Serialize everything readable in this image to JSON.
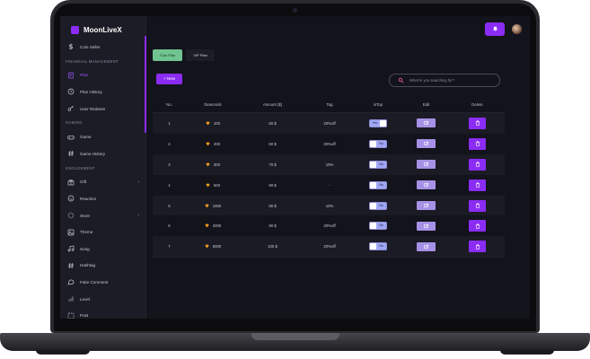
{
  "app": {
    "brand": "MoonLiveX"
  },
  "sidebar": {
    "items": [
      {
        "type": "item",
        "label": "Coin Seller",
        "icon": "dollar-icon"
      },
      {
        "type": "section",
        "label": "FINANCIAL MANAGEMENT"
      },
      {
        "type": "item",
        "label": "Plan",
        "icon": "plan-icon",
        "active": true
      },
      {
        "type": "item",
        "label": "Plan History",
        "icon": "clock-icon"
      },
      {
        "type": "item",
        "label": "User Redeem",
        "icon": "key-icon"
      },
      {
        "type": "section",
        "label": "GAMING"
      },
      {
        "type": "item",
        "label": "Game",
        "icon": "gamepad-icon"
      },
      {
        "type": "item",
        "label": "Game History",
        "icon": "hash-icon"
      },
      {
        "type": "section",
        "label": "ENGAGEMENT"
      },
      {
        "type": "item",
        "label": "Gift",
        "icon": "gift-icon",
        "chevron": "›"
      },
      {
        "type": "item",
        "label": "Reaction",
        "icon": "smile-icon"
      },
      {
        "type": "item",
        "label": "Store",
        "icon": "loader-icon",
        "chevron": "›"
      },
      {
        "type": "item",
        "label": "Theme",
        "icon": "image-icon"
      },
      {
        "type": "item",
        "label": "Song",
        "icon": "music-icon"
      },
      {
        "type": "item",
        "label": "Hashtag",
        "icon": "hash-icon"
      },
      {
        "type": "item",
        "label": "Fake Comment",
        "icon": "comment-icon"
      },
      {
        "type": "item",
        "label": "Level",
        "icon": "bar-chart-icon"
      },
      {
        "type": "item",
        "label": "Post",
        "icon": "post-icon"
      }
    ]
  },
  "tabs": [
    {
      "label": "Coin Plan",
      "active": true
    },
    {
      "label": "VIP Plan",
      "active": false
    }
  ],
  "toolbar": {
    "new_label": "+ New"
  },
  "search": {
    "placeholder": "What're you searching for?"
  },
  "table": {
    "headers": [
      "No.",
      "Diamonds",
      "Amount ($)",
      "Tag",
      "isTop",
      "Edit",
      "Delete"
    ],
    "rows": [
      {
        "no": "1",
        "diamonds": "100",
        "amount": "50 $",
        "tag": "20%off",
        "isTop": "Yes",
        "top_on": true
      },
      {
        "no": "2",
        "diamonds": "200",
        "amount": "60 $",
        "tag": "20%off",
        "isTop": "No",
        "top_on": false
      },
      {
        "no": "3",
        "diamonds": "300",
        "amount": "70 $",
        "tag": "10%",
        "isTop": "No",
        "top_on": false
      },
      {
        "no": "4",
        "diamonds": "500",
        "amount": "80 $",
        "tag": "-",
        "isTop": "No",
        "top_on": false
      },
      {
        "no": "5",
        "diamonds": "1000",
        "amount": "85 $",
        "tag": "10%",
        "isTop": "No",
        "top_on": false
      },
      {
        "no": "6",
        "diamonds": "2000",
        "amount": "90 $",
        "tag": "20%off",
        "isTop": "No",
        "top_on": false
      },
      {
        "no": "7",
        "diamonds": "5000",
        "amount": "100 $",
        "tag": "20%off",
        "isTop": "No",
        "top_on": false
      }
    ]
  },
  "colors": {
    "accent": "#8b2cf5",
    "tab_active": "#6fc48f",
    "edit": "#a691e6",
    "diamond": "#f5a623"
  }
}
